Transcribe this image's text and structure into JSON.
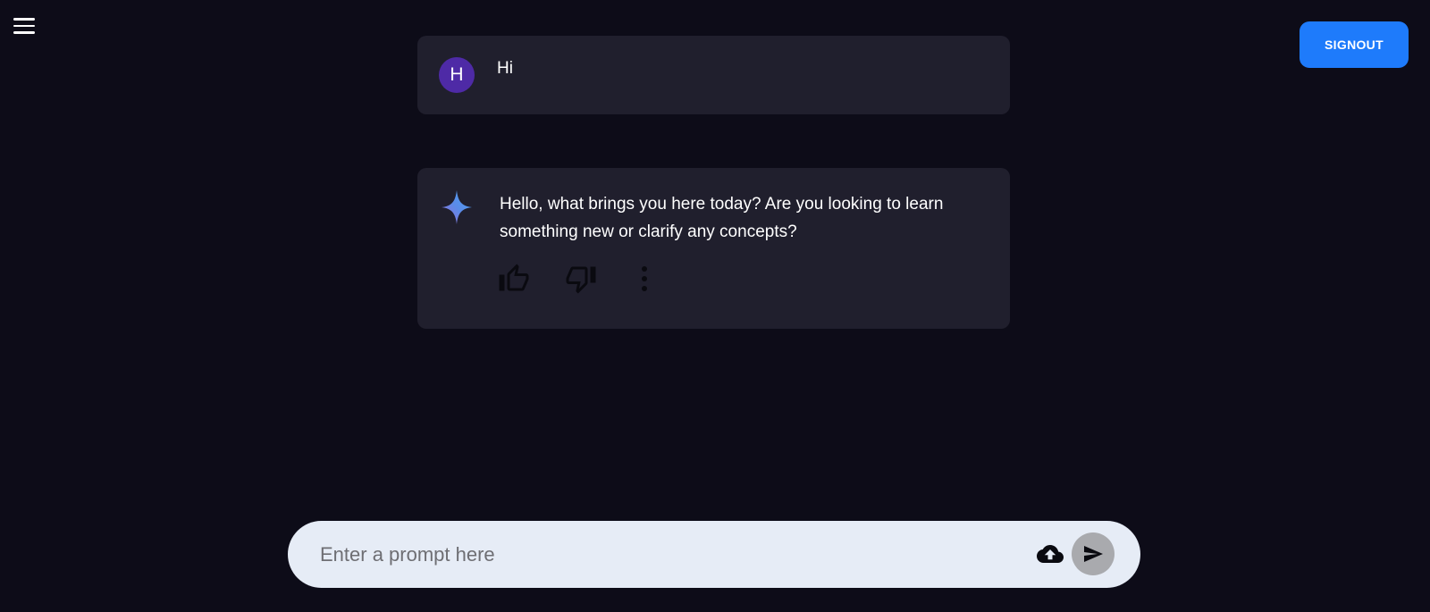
{
  "header": {
    "menu_icon": "hamburger-menu-icon",
    "signout_label": "SIGNOUT",
    "signout_color": "#1e7bfb"
  },
  "conversation": {
    "user_message": {
      "avatar_initial": "H",
      "avatar_color": "#4e2aa6",
      "text": "Hi"
    },
    "bot_message": {
      "icon": "sparkle-icon",
      "text": "Hello, what brings you here today? Are you looking to learn something new or clarify any concepts?",
      "actions": [
        "thumbs-up-icon",
        "thumbs-down-icon",
        "more-vertical-icon"
      ]
    }
  },
  "prompt": {
    "placeholder": "Enter a prompt here",
    "value": "",
    "upload_icon": "cloud-upload-icon",
    "send_icon": "send-icon"
  },
  "colors": {
    "background": "#0d0c18",
    "message_card": "#201f2d",
    "prompt_bar": "#e6ecf6"
  }
}
